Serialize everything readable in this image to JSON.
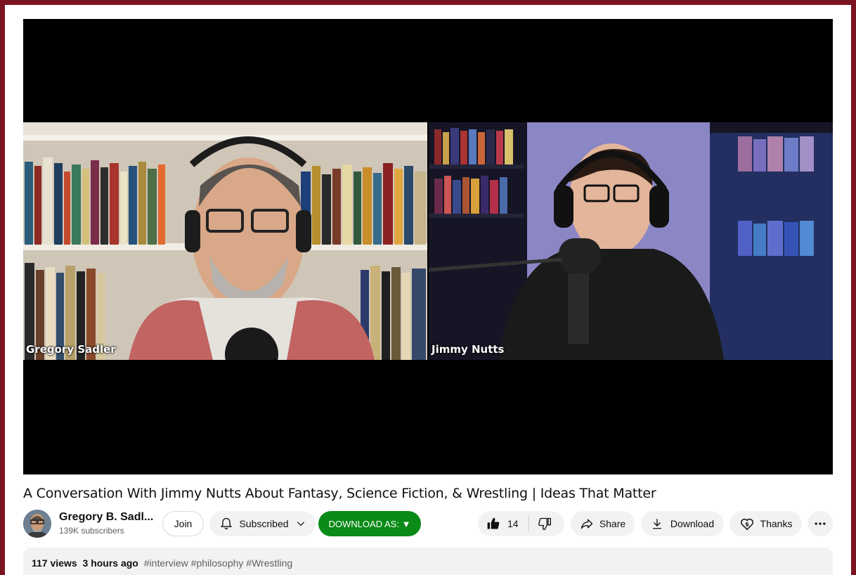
{
  "video": {
    "participants": [
      {
        "name": "Gregory Sadler"
      },
      {
        "name": "Jimmy Nutts"
      }
    ],
    "title": "A Conversation With Jimmy Nutts About Fantasy, Science Fiction, & Wrestling | Ideas That Matter"
  },
  "channel": {
    "name": "Gregory B. Sadl...",
    "subscribers": "139K subscribers",
    "join_label": "Join",
    "subscribed_label": "Subscribed"
  },
  "actions": {
    "download_as_label": "DOWNLOAD AS: ▼",
    "likes": "14",
    "share_label": "Share",
    "download_label": "Download",
    "thanks_label": "Thanks",
    "more_icon": "more-horizontal-icon"
  },
  "description": {
    "views": "117 views",
    "time": "3 hours ago",
    "hashtags": "#interview #philosophy #Wrestling"
  },
  "colors": {
    "frame": "#7a1420",
    "download_as_button": "#0a8a17"
  }
}
